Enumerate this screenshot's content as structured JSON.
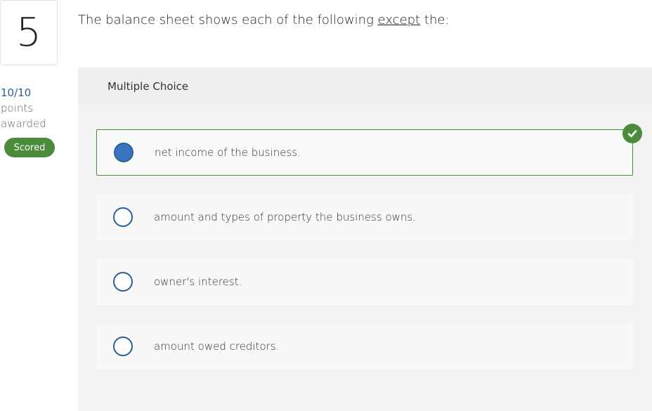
{
  "question": {
    "number": "5",
    "text_before": "The balance sheet shows each of the following ",
    "text_emphasis": "except",
    "text_after": " the:"
  },
  "points": {
    "score": "10/10",
    "label_line1": "points",
    "label_line2": "awarded",
    "badge": "Scored"
  },
  "panel": {
    "header": "Multiple Choice",
    "choices": [
      {
        "label": "net income of the business.",
        "selected": true,
        "correct": true
      },
      {
        "label": "amount and types of property the business owns.",
        "selected": false
      },
      {
        "label": "owner's interest.",
        "selected": false
      },
      {
        "label": "amount owed creditors.",
        "selected": false
      }
    ]
  },
  "colors": {
    "accent_blue": "#2a5f99",
    "radio_fill": "#3873bd",
    "success_green": "#4c8a3c"
  },
  "icons": {
    "correct": "checkmark-circle-icon",
    "choice": "radio-button-icon"
  }
}
